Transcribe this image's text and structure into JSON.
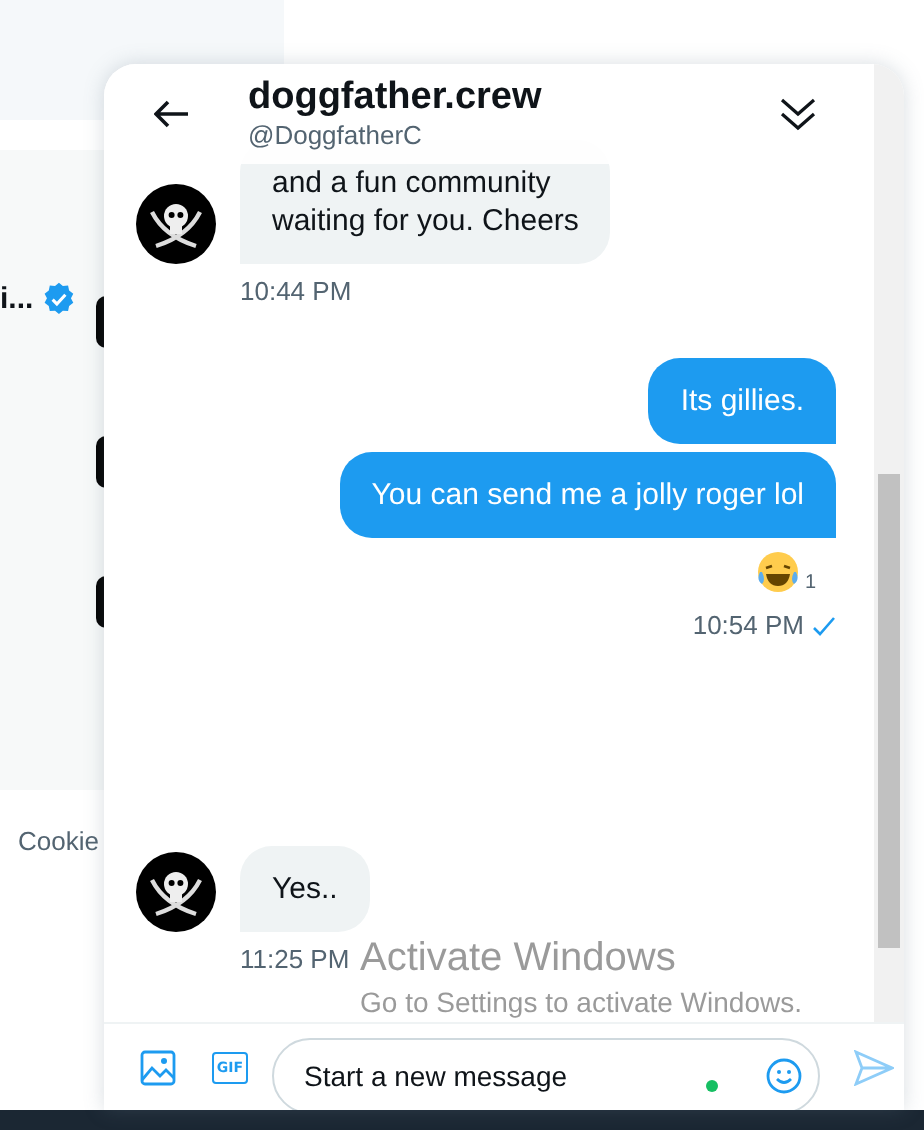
{
  "background_page": {
    "name_fragment": "i...",
    "verified": true,
    "footer_link": "Cookie"
  },
  "conversation": {
    "display_name": "doggfather.crew",
    "handle": "@DoggfatherC"
  },
  "messages": [
    {
      "kind": "received",
      "lines": [
        "and a fun community",
        "waiting for you. Cheers"
      ],
      "time": "10:44 PM"
    },
    {
      "kind": "sent",
      "lines": [
        "Its gillies."
      ]
    },
    {
      "kind": "sent",
      "lines": [
        "You can send me a jolly roger lol"
      ],
      "reaction_count": "1",
      "time": "10:54 PM",
      "seen": true
    },
    {
      "kind": "received",
      "lines": [
        "Yes.."
      ],
      "time": "11:25 PM"
    }
  ],
  "os_notice": {
    "title": "Activate Windows",
    "text": "Go to Settings to activate Windows."
  },
  "composer": {
    "gif_label": "GIF",
    "placeholder": "Start a new message",
    "online": true
  }
}
